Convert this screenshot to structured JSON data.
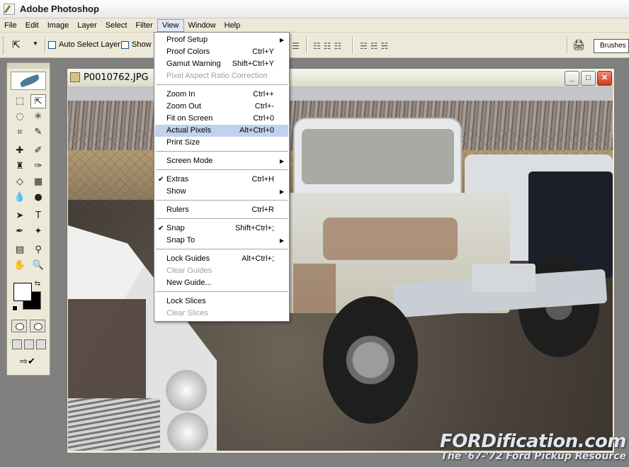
{
  "app": {
    "title": "Adobe Photoshop"
  },
  "menubar": {
    "items": [
      "File",
      "Edit",
      "Image",
      "Layer",
      "Select",
      "Filter",
      "View",
      "Window",
      "Help"
    ],
    "active": "View"
  },
  "options": {
    "auto_select_label": "Auto Select Layer",
    "show_label": "Show B",
    "brushes_label": "Brushes"
  },
  "document": {
    "title": "P0010762.JPG"
  },
  "view_menu": {
    "items": [
      {
        "label": "Proof Setup",
        "shortcut": "",
        "submenu": true
      },
      {
        "label": "Proof Colors",
        "shortcut": "Ctrl+Y"
      },
      {
        "label": "Gamut Warning",
        "shortcut": "Shift+Ctrl+Y"
      },
      {
        "label": "Pixel Aspect Ratio Correction",
        "shortcut": "",
        "disabled": true
      },
      {
        "label": "Zoom In",
        "shortcut": "Ctrl++"
      },
      {
        "label": "Zoom Out",
        "shortcut": "Ctrl+-"
      },
      {
        "label": "Fit on Screen",
        "shortcut": "Ctrl+0"
      },
      {
        "label": "Actual Pixels",
        "shortcut": "Alt+Ctrl+0",
        "highlighted": true
      },
      {
        "label": "Print Size",
        "shortcut": ""
      },
      {
        "label": "Screen Mode",
        "shortcut": "",
        "submenu": true
      },
      {
        "label": "Extras",
        "shortcut": "Ctrl+H",
        "checked": true
      },
      {
        "label": "Show",
        "shortcut": "",
        "submenu": true
      },
      {
        "label": "Rulers",
        "shortcut": "Ctrl+R"
      },
      {
        "label": "Snap",
        "shortcut": "Shift+Ctrl+;",
        "checked": true
      },
      {
        "label": "Snap To",
        "shortcut": "",
        "submenu": true
      },
      {
        "label": "Lock Guides",
        "shortcut": "Alt+Ctrl+;"
      },
      {
        "label": "Clear Guides",
        "shortcut": "",
        "disabled": true
      },
      {
        "label": "New Guide...",
        "shortcut": ""
      },
      {
        "label": "Lock Slices",
        "shortcut": ""
      },
      {
        "label": "Clear Slices",
        "shortcut": "",
        "disabled": true
      }
    ],
    "check_glyph": "✔",
    "arrow_glyph": "▶"
  },
  "watermark": {
    "title": "FORDification.com",
    "subtitle": "The '67-'72 Ford Pickup Resource"
  },
  "colors": {
    "menu_highlight": "#c1d2ee",
    "menubar_bg": "#ece9d8",
    "close_button": "#c43a1e"
  }
}
